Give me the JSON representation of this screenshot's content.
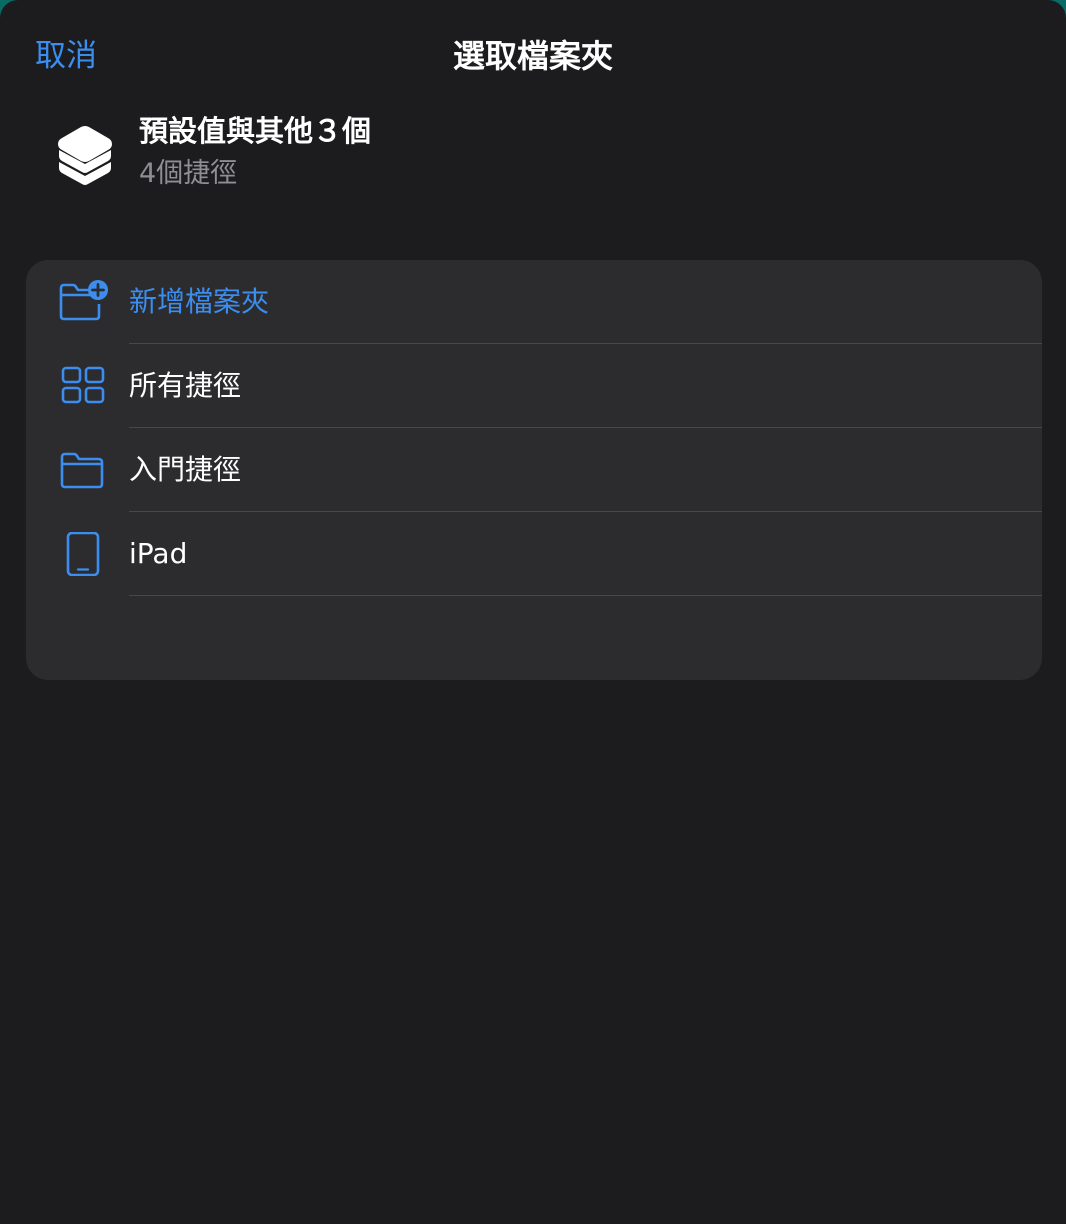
{
  "nav": {
    "cancel_label": "取消",
    "title": "選取檔案夾"
  },
  "header": {
    "icon": "layers-icon",
    "title": "預設值與其他３個",
    "subtitle": "4個捷徑"
  },
  "list": {
    "items": [
      {
        "label": "新增檔案夾",
        "icon": "folder-plus-icon",
        "accent": true
      },
      {
        "label": "所有捷徑",
        "icon": "grid-icon",
        "accent": false
      },
      {
        "label": "入門捷徑",
        "icon": "folder-icon",
        "accent": false
      },
      {
        "label": "iPad",
        "icon": "ipad-icon",
        "accent": false
      }
    ]
  },
  "colors": {
    "accent": "#3b8ef0",
    "background": "#1c1c1e",
    "group_background": "#2c2c2e",
    "separator": "#48484a",
    "secondary_text": "#8e8e93"
  }
}
